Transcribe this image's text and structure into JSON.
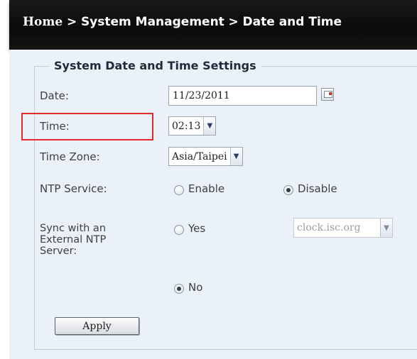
{
  "breadcrumb": {
    "home": "Home",
    "separator": ">",
    "level1": "System Management",
    "level2": "Date and Time"
  },
  "section": {
    "title": "System Date and Time Settings"
  },
  "fields": {
    "date": {
      "label": "Date:",
      "value": "11/23/2011"
    },
    "time": {
      "label": "Time:",
      "value": "02:13"
    },
    "time_zone": {
      "label": "Time Zone:",
      "value": "Asia/Taipei"
    },
    "ntp_service": {
      "label": "NTP Service:",
      "enable": "Enable",
      "disable": "Disable",
      "selected": "Disable"
    },
    "sync_external": {
      "label_line1": "Sync with an",
      "label_line2": "External NTP",
      "label_line3": "Server:",
      "yes": "Yes",
      "no": "No",
      "selected": "No",
      "server": "clock.isc.org"
    }
  },
  "actions": {
    "apply": "Apply"
  },
  "colors": {
    "highlight": "#e5262a",
    "header_bg": "#111111",
    "panel_bg": "#ebf1f9"
  },
  "icons": {
    "calendar": "calendar-icon",
    "dropdown": "chevron-down-icon"
  }
}
